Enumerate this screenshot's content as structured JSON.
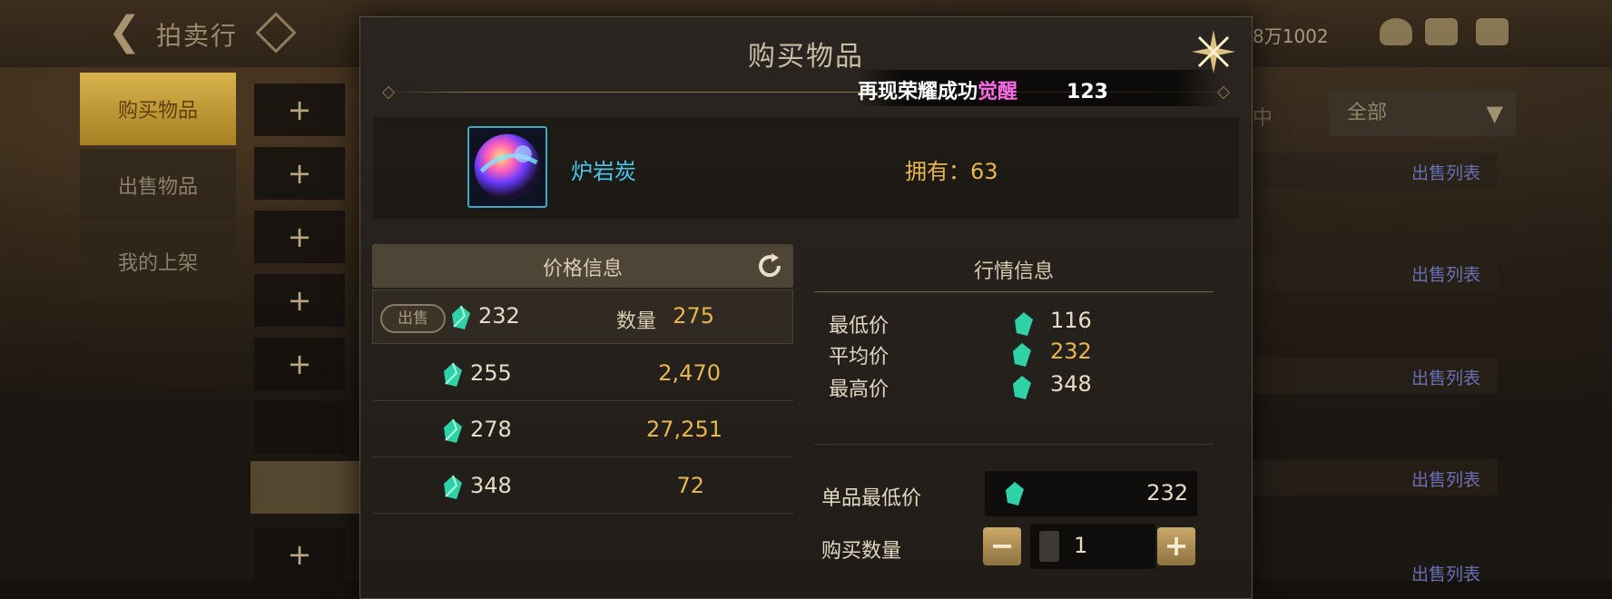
{
  "topbar": {
    "title": "拍卖行",
    "currency_partial": "8万1002"
  },
  "sidebar": {
    "tabs": [
      {
        "label": "购买物品",
        "active": true
      },
      {
        "label": "出售物品",
        "active": false
      },
      {
        "label": "我的上架",
        "active": false
      }
    ]
  },
  "background": {
    "filter_label_partial": "中",
    "filter_value": "全部",
    "list_link": "出售列表",
    "list_link_count": 5
  },
  "dialog": {
    "title": "购买物品",
    "ticker": {
      "text": "再现荣耀成功",
      "highlight": "觉醒",
      "number": "123"
    },
    "item": {
      "name": "炉岩炭",
      "own_label": "拥有：63"
    },
    "price_info": {
      "header": "价格信息",
      "sell_badge": "出售",
      "qty_label": "数量",
      "rows": [
        {
          "price": "232",
          "qty": "275"
        },
        {
          "price": "255",
          "qty": "2,470"
        },
        {
          "price": "278",
          "qty": "27,251"
        },
        {
          "price": "348",
          "qty": "72"
        }
      ]
    },
    "market": {
      "header": "行情信息",
      "lowest_label": "最低价",
      "lowest": "116",
      "average_label": "平均价",
      "average": "232",
      "highest_label": "最高价",
      "highest": "348"
    },
    "form": {
      "unit_min_label": "单品最低价",
      "unit_min_value": "232",
      "quantity_label": "购买数量",
      "quantity_value": "1"
    }
  },
  "colors": {
    "accent_gold": "#e8b64e",
    "item_name": "#4cc6e6",
    "ticker_highlight": "#ff6ae6"
  }
}
